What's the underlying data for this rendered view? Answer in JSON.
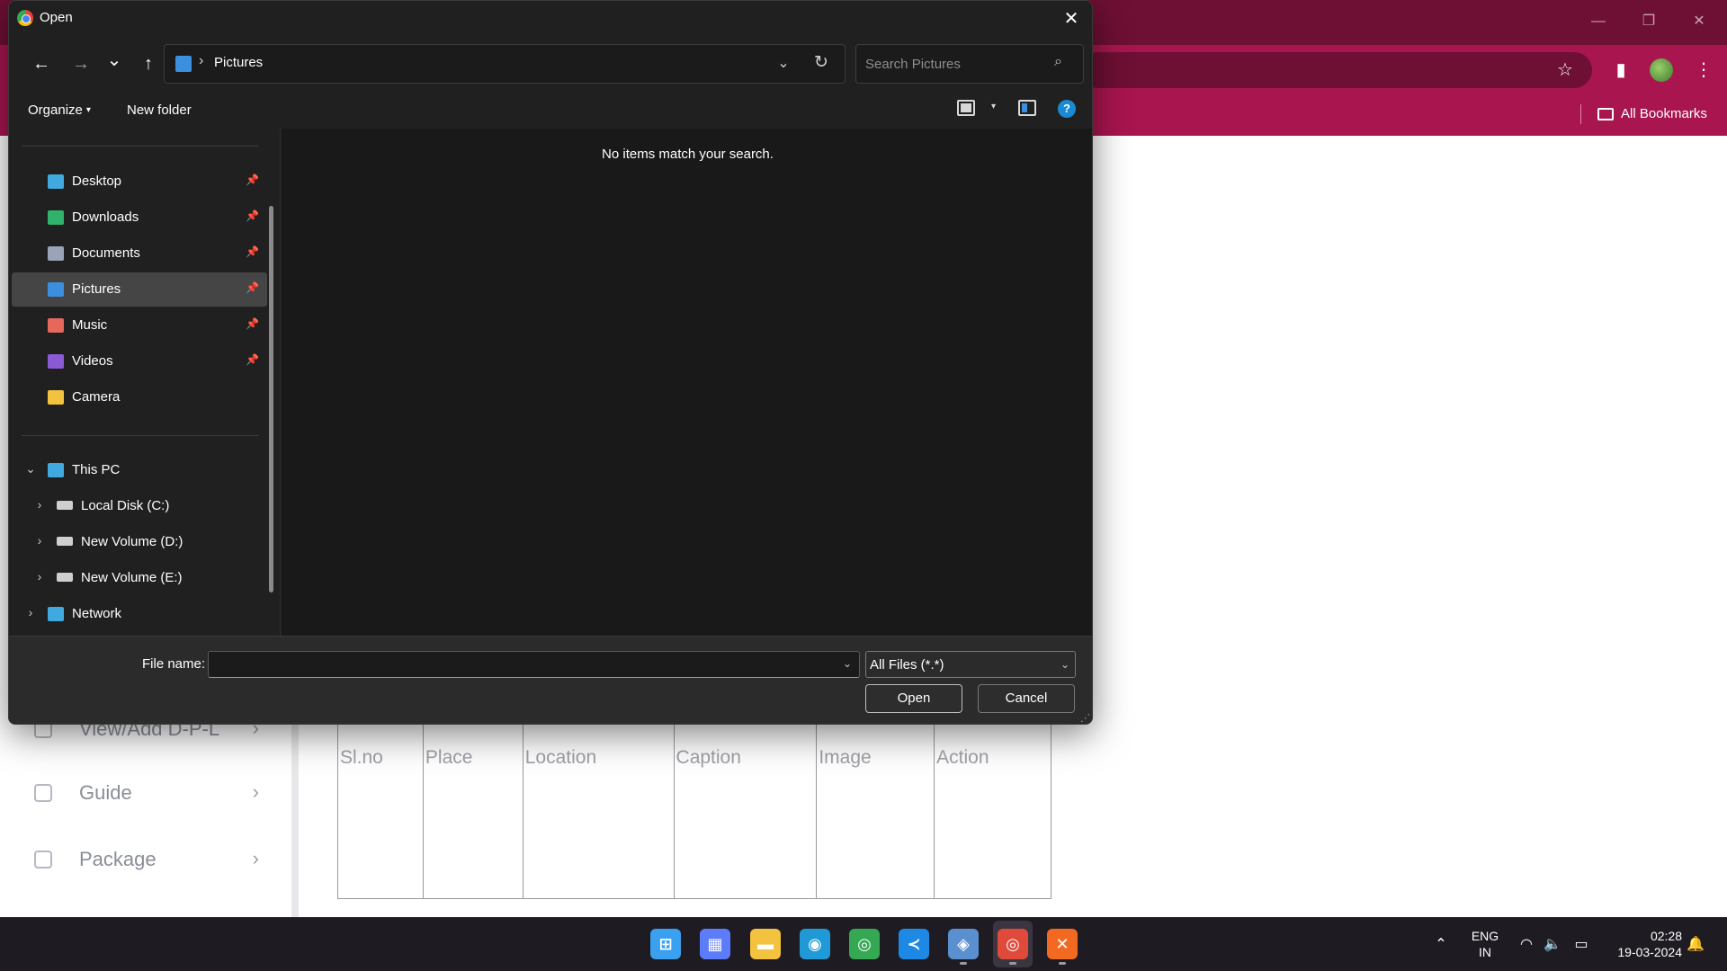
{
  "dialog": {
    "title": "Open",
    "close_glyph": "✕",
    "nav": {
      "back": "←",
      "forward": "→",
      "recent": "⌄",
      "up": "↑"
    },
    "address": {
      "separator": "›",
      "path": "Pictures",
      "dropdown_glyph": "⌄",
      "refresh_glyph": "↻"
    },
    "search": {
      "placeholder": "Search Pictures",
      "glyph": "⌕"
    },
    "commands": {
      "organize": "Organize",
      "organize_caret": "▾",
      "new_folder": "New folder",
      "view_caret": "▾",
      "help": "?"
    },
    "quick_access": [
      {
        "label": "Desktop",
        "icon": "desktop-icon",
        "color": "#3fa9e0",
        "pinned": true
      },
      {
        "label": "Downloads",
        "icon": "download-icon",
        "color": "#2fb36c",
        "pinned": true
      },
      {
        "label": "Documents",
        "icon": "document-icon",
        "color": "#9aa4b8",
        "pinned": true
      },
      {
        "label": "Pictures",
        "icon": "pictures-icon",
        "color": "#3b8fde",
        "pinned": true,
        "selected": true
      },
      {
        "label": "Music",
        "icon": "music-icon",
        "color": "#e5685a",
        "pinned": true
      },
      {
        "label": "Videos",
        "icon": "video-icon",
        "color": "#8b5bd6",
        "pinned": true
      },
      {
        "label": "Camera",
        "icon": "folder-icon",
        "color": "#f3c23e",
        "pinned": false
      }
    ],
    "pin_glyph": "📌",
    "this_pc": {
      "label": "This PC",
      "expand_glyph": "⌄"
    },
    "drives": [
      {
        "label": "Local Disk (C:)",
        "expand_glyph": "›"
      },
      {
        "label": "New Volume (D:)",
        "expand_glyph": "›"
      },
      {
        "label": "New Volume (E:)",
        "expand_glyph": "›"
      }
    ],
    "network": {
      "label": "Network",
      "expand_glyph": "›"
    },
    "empty_message": "No items match your search.",
    "footer": {
      "file_name_label": "File name:",
      "file_name_value": "",
      "filter_value": "All Files (*.*)",
      "dropdown_glyph": "⌄",
      "open_label": "Open",
      "cancel_label": "Cancel",
      "grip_glyph": "⋰"
    }
  },
  "browser": {
    "window_controls": {
      "minimize": "—",
      "restore": "❐",
      "close": "✕"
    },
    "toolbar": {
      "star": "☆",
      "side_panel": "▮",
      "menu": "⋮"
    },
    "bookmarks_label": "All Bookmarks"
  },
  "page": {
    "sidebar_items": [
      {
        "label": "View/Add D-P-L",
        "chevron": "›"
      },
      {
        "label": "Guide",
        "chevron": "›"
      },
      {
        "label": "Package",
        "chevron": "›"
      }
    ],
    "table_headers": [
      "Sl.no",
      "Place",
      "Location",
      "Caption",
      "Image",
      "Action"
    ]
  },
  "taskbar": {
    "apps": [
      {
        "name": "windows-start-icon",
        "glyph": "⊞",
        "color": "#3aa0f0"
      },
      {
        "name": "microsoft-store-icon",
        "glyph": "▦",
        "color": "#5c7cfa"
      },
      {
        "name": "file-explorer-icon",
        "glyph": "▬",
        "color": "#f3c23e"
      },
      {
        "name": "edge-icon",
        "glyph": "◉",
        "color": "#1f9ad6"
      },
      {
        "name": "chrome-icon",
        "glyph": "◎",
        "color": "#34a853"
      },
      {
        "name": "vscode-icon",
        "glyph": "≺",
        "color": "#1e88e5"
      },
      {
        "name": "virtualbox-icon",
        "glyph": "◈",
        "color": "#5a8fd0"
      },
      {
        "name": "chrome-profile-icon",
        "glyph": "◎",
        "color": "#e04a3b"
      },
      {
        "name": "xampp-icon",
        "glyph": "✕",
        "color": "#f26a22"
      }
    ],
    "tray": {
      "chevron": "⌃",
      "lang_line1": "ENG",
      "lang_line2": "IN",
      "wifi": "◠",
      "volume": "🔈",
      "battery": "▭",
      "time": "02:28",
      "date": "19-03-2024",
      "notification": "🔔"
    }
  }
}
